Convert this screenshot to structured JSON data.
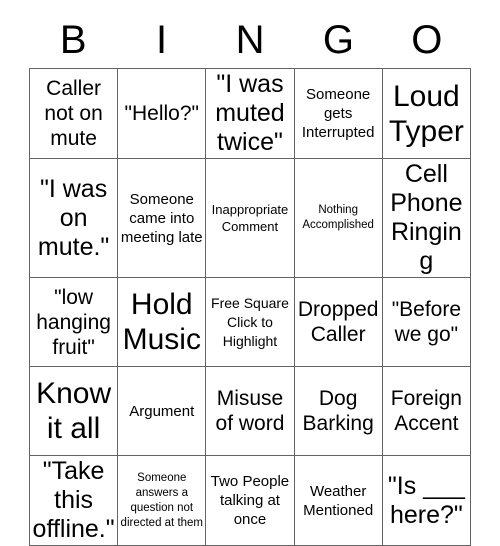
{
  "card": {
    "title": "BINGO",
    "header_letters": [
      "B",
      "I",
      "N",
      "G",
      "O"
    ],
    "grid_line_color": "#646464",
    "text_color": "#000000",
    "background_color": "#ffffff",
    "columns": 5,
    "rows": 5,
    "cells": [
      [
        {
          "text": "Caller not on mute",
          "size": "sz-md"
        },
        {
          "text": "\"Hello?\"",
          "size": "sz-md"
        },
        {
          "text": "\"I was muted twice\"",
          "size": "sz-lg"
        },
        {
          "text": "Someone gets Interrupted",
          "size": "sz-sm"
        },
        {
          "text": "Loud Typer",
          "size": "sz-xl"
        }
      ],
      [
        {
          "text": "\"I was on mute.\"",
          "size": "sz-lg"
        },
        {
          "text": "Someone came into meeting late",
          "size": "sz-sm"
        },
        {
          "text": "Inappropriate Comment",
          "size": "sz-xs"
        },
        {
          "text": "Nothing Accomplished",
          "size": "sz-xxs"
        },
        {
          "text": "Cell Phone Ringing",
          "size": "sz-lg"
        }
      ],
      [
        {
          "text": "\"low hanging fruit\"",
          "size": "sz-md"
        },
        {
          "text": "Hold Music",
          "size": "sz-xl"
        },
        {
          "text": "Free Square Click to Highlight",
          "size": "free-cell",
          "free": true
        },
        {
          "text": "Dropped Caller",
          "size": "sz-md"
        },
        {
          "text": "\"Before we go\"",
          "size": "sz-md"
        }
      ],
      [
        {
          "text": "Know it all",
          "size": "sz-xl"
        },
        {
          "text": "Argument",
          "size": "sz-sm"
        },
        {
          "text": "Misuse of word",
          "size": "sz-md"
        },
        {
          "text": "Dog Barking",
          "size": "sz-md"
        },
        {
          "text": "Foreign Accent",
          "size": "sz-md"
        }
      ],
      [
        {
          "text": "\"Take this offline.\"",
          "size": "sz-lg"
        },
        {
          "text": "Someone answers a question not directed at them",
          "size": "sz-xxs"
        },
        {
          "text": "Two People talking at once",
          "size": "sz-sm"
        },
        {
          "text": "Weather Mentioned",
          "size": "sz-sm"
        },
        {
          "text": "\"Is ___ here?\"",
          "size": "sz-lg"
        }
      ]
    ]
  }
}
